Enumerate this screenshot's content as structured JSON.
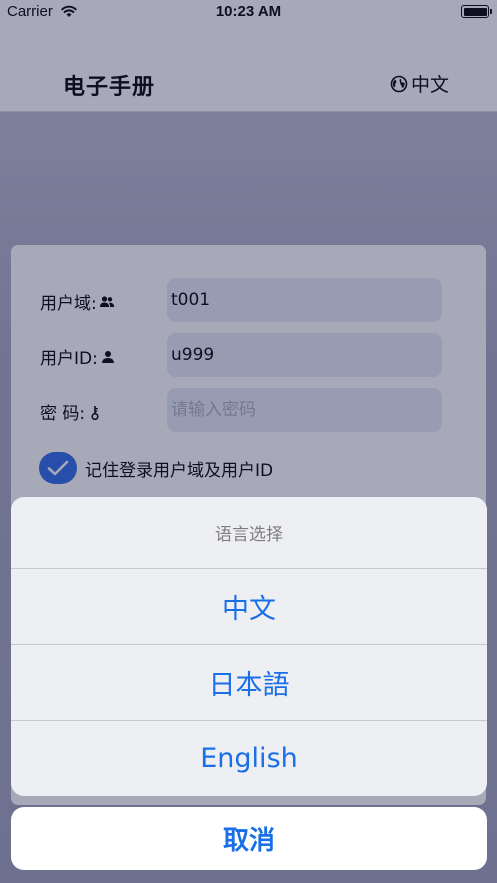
{
  "status_bar": {
    "carrier": "Carrier",
    "time": "10:23 AM"
  },
  "header": {
    "title": "电子手册",
    "language_label": "中文"
  },
  "login_form": {
    "domain_label": "用户域:",
    "domain_value": "t001",
    "user_id_label": "用户ID:",
    "user_id_value": "u999",
    "password_label": "密 码:",
    "password_placeholder": "请输入密码",
    "remember_label": "记住登录用户域及用户ID",
    "remember_checked": true
  },
  "language_sheet": {
    "title": "语言选择",
    "options": [
      "中文",
      "日本語",
      "English"
    ],
    "cancel_label": "取消"
  },
  "icons": {
    "wifi": "wifi-icon",
    "battery": "battery-icon",
    "globe": "globe-icon",
    "users": "users-icon",
    "user": "user-icon",
    "key": "key-icon",
    "check": "check-icon"
  },
  "colors": {
    "accent": "#1a6fe8",
    "checkbox": "#2a6ae8",
    "input_bg": "#e6ecf6",
    "sheet_bg": "#eeeff2"
  }
}
